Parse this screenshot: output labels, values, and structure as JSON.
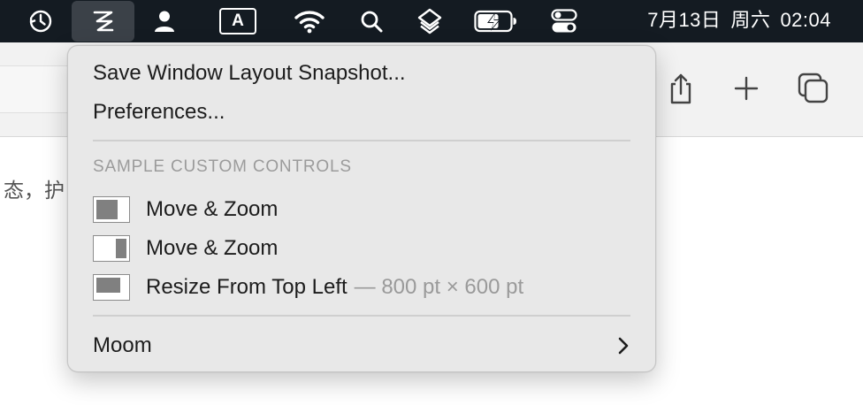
{
  "menubar": {
    "icons": [
      "time-machine-icon",
      "moom-icon",
      "user-icon",
      "input-source-icon",
      "wifi-icon",
      "spotlight-icon",
      "layers-icon",
      "battery-icon",
      "control-center-icon"
    ],
    "input_source_label": "A",
    "date": "7月13日",
    "weekday": "周六",
    "time": "02:04"
  },
  "browser": {
    "toolbar_icons": [
      "share-icon",
      "new-tab-icon",
      "tab-overview-icon"
    ],
    "page_text": "态，护"
  },
  "menu": {
    "save_snapshot": "Save Window Layout Snapshot...",
    "preferences": "Preferences...",
    "section_header": "SAMPLE CUSTOM CONTROLS",
    "controls": [
      {
        "label": "Move & Zoom",
        "detail": "",
        "icon": "left-half-icon"
      },
      {
        "label": "Move & Zoom",
        "detail": "",
        "icon": "right-third-icon"
      },
      {
        "label": "Resize From Top Left",
        "detail": "— 800 pt × 600 pt",
        "icon": "top-left-icon"
      }
    ],
    "moom": "Moom",
    "moom_submenu_icon": "chevron-right-icon"
  },
  "colors": {
    "menubar_bg": "#141b22",
    "menubar_active": "#3b4148",
    "menu_bg": "#e8e8e8",
    "swatch_fill": "#808080"
  }
}
